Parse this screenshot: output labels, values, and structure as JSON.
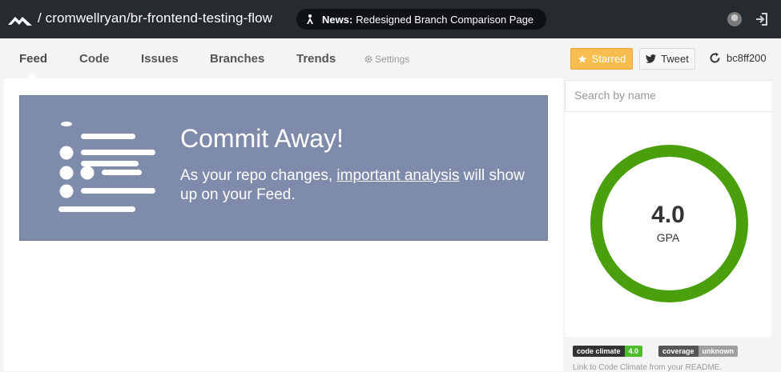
{
  "header": {
    "logo_icon": "code-climate-logo-icon",
    "repo_path": "/ cromwellryan/br-frontend-testing-flow",
    "news": {
      "icon": "astronaut-icon",
      "label": "News:",
      "text": "Redesigned Branch Comparison Page"
    },
    "avatar_icon": "user-avatar",
    "signin_icon": "sign-in-icon"
  },
  "nav": {
    "items": [
      {
        "label": "Feed",
        "active": true
      },
      {
        "label": "Code",
        "active": false
      },
      {
        "label": "Issues",
        "active": false
      },
      {
        "label": "Branches",
        "active": false
      },
      {
        "label": "Trends",
        "active": false
      }
    ],
    "settings_label": "Settings",
    "settings_icon": "gear-icon"
  },
  "actions": {
    "starred_label": "Starred",
    "starred_icon": "star-icon",
    "tweet_label": "Tweet",
    "tweet_icon": "twitter-icon",
    "commit_icon": "refresh-icon",
    "commit_sha": "bc8ff200"
  },
  "feed": {
    "title": "Commit Away!",
    "text_before": "As your repo changes, ",
    "link_text": "important analysis",
    "text_after": " will show up on your Feed.",
    "illustration_icon": "list-illustration-icon"
  },
  "sidebar": {
    "search_placeholder": "Search by name",
    "gpa_value": "4.0",
    "gpa_label": "GPA",
    "gpa_color": "#4a9f0c",
    "badges": {
      "cc_left": "code climate",
      "cc_right": "4.0",
      "coverage_left": "coverage",
      "coverage_right": "unknown"
    },
    "readme_note": "Link to Code Climate from your README."
  },
  "colors": {
    "topbar": "#262b30",
    "card": "#7f8bab",
    "starred": "#f7bd4f"
  }
}
